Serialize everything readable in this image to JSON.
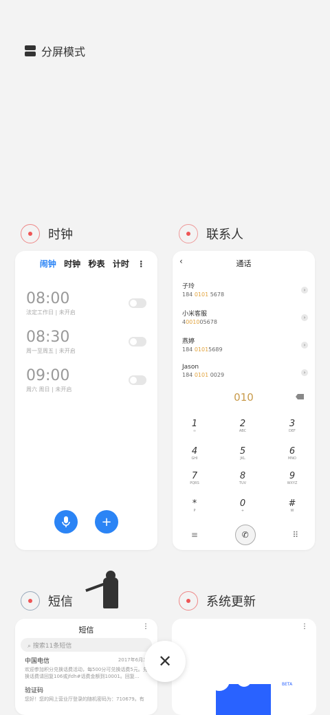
{
  "split_mode": {
    "label": "分屏模式"
  },
  "clock": {
    "title": "时钟",
    "tabs": [
      "闹钟",
      "时钟",
      "秒表",
      "计时"
    ],
    "menu": "⋮",
    "alarms": [
      {
        "time": "08:00",
        "sub": "法定工作日 | 未开启"
      },
      {
        "time": "08:30",
        "sub": "周一至周五 | 未开启"
      },
      {
        "time": "09:00",
        "sub": "周六 周日 | 未开启"
      }
    ],
    "accent": "#2b84f5"
  },
  "contacts": {
    "title": "联系人",
    "header": "通话",
    "list": [
      {
        "name": "子玲",
        "pre": "184 ",
        "hl": "0101",
        "post": " 5678"
      },
      {
        "name": "小米客服",
        "pre": "4",
        "hl": "0010",
        "post": "05678"
      },
      {
        "name": "燕婷",
        "pre": "184 ",
        "hl": "0101",
        "post": "5689"
      },
      {
        "name": "Jason",
        "pre": "184 ",
        "hl": "0101",
        "post": " 0029"
      }
    ],
    "dialed": "010",
    "keys": [
      {
        "d": "1",
        "l": "∞"
      },
      {
        "d": "2",
        "l": "ABC"
      },
      {
        "d": "3",
        "l": "DEF"
      },
      {
        "d": "4",
        "l": "GHI"
      },
      {
        "d": "5",
        "l": "JKL"
      },
      {
        "d": "6",
        "l": "MNO"
      },
      {
        "d": "7",
        "l": "PQRS"
      },
      {
        "d": "8",
        "l": "TUV"
      },
      {
        "d": "9",
        "l": "WXYZ"
      },
      {
        "d": "*",
        "l": "P"
      },
      {
        "d": "0",
        "l": "+"
      },
      {
        "d": "#",
        "l": "W"
      }
    ]
  },
  "sms": {
    "title": "短信",
    "header": "短信",
    "search_placeholder": "搜索11条短信",
    "messages": [
      {
        "title": "中国电信",
        "date": "2017年6月30",
        "body": "欢迎参加积分兑换话费活动，每500分可兑换话费5元。兑换话费请回复106或jfdh#话费金额到10001。回复..."
      },
      {
        "title": "验证码",
        "date": "",
        "body": "您好！您的网上营业厅登录的随机密码为：710679。有"
      }
    ]
  },
  "update": {
    "title": "系统更新",
    "beta": "BETA"
  },
  "close": "✕"
}
